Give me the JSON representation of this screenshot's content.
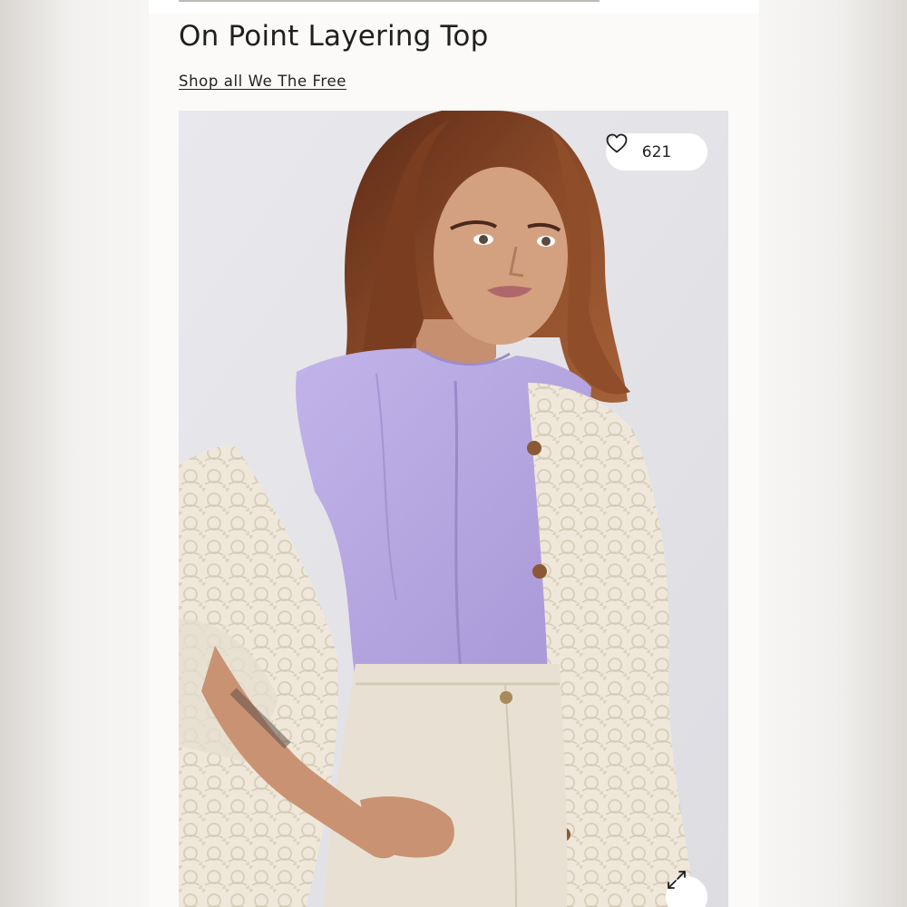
{
  "product": {
    "title": "On Point Layering Top",
    "shop_link": "Shop all We The Free"
  },
  "gallery": {
    "favorite_count": "621",
    "favorite_icon": "heart-outline-icon",
    "expand_icon": "expand-arrows-icon"
  },
  "colors": {
    "top": "#b3a3de",
    "lace_jacket": "#eee7da",
    "pants": "#e7e0d2",
    "hair": "#7a4126",
    "backdrop": "#e4e4e8"
  }
}
